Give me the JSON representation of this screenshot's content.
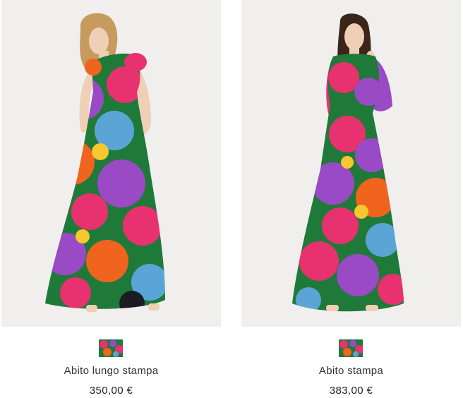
{
  "products": [
    {
      "name": "Abito lungo stampa",
      "price": "350,00 €",
      "image": "model-floral-maxi-dress-short-sleeve",
      "swatch": "floral-print-swatch"
    },
    {
      "name": "Abito stampa",
      "price": "383,00 €",
      "image": "model-floral-maxi-dress-long-sleeve",
      "swatch": "floral-print-swatch"
    }
  ],
  "colors": {
    "photo_background": "#f1efed",
    "text": "#333333",
    "print_pink": "#e8316f",
    "print_purple": "#9a4ac4",
    "print_blue": "#5aa5d6",
    "print_orange": "#f0641e",
    "print_green": "#1f7a3a",
    "print_dark": "#1c1c24"
  }
}
